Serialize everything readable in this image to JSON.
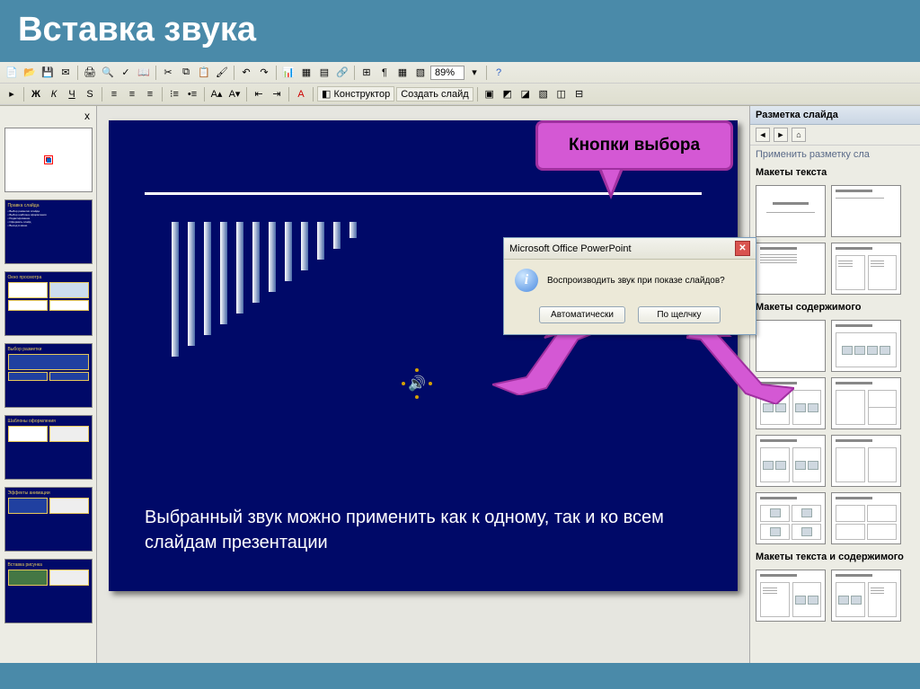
{
  "title": "Вставка звука",
  "toolbar": {
    "zoom": "89%",
    "designer_btn": "Конструктор",
    "new_slide_btn": "Создать слайд",
    "font_btns": [
      "Ж",
      "К",
      "Ч",
      "S"
    ]
  },
  "thumbs_close": "x",
  "callout_label": "Кнопки выбора",
  "dialog": {
    "title": "Microsoft Office PowerPoint",
    "message": "Воспроизводить звук при показе слайдов?",
    "btn_auto": "Автоматически",
    "btn_click": "По щелчку"
  },
  "slide_text": "Выбранный звук можно применить как к одному, так и ко всем слайдам презентации",
  "taskpane": {
    "header": "Разметка слайда",
    "subheader": "Применить разметку сла",
    "section_text": "Макеты текста",
    "section_content": "Макеты содержимого",
    "section_text_content": "Макеты текста и содержимого"
  }
}
